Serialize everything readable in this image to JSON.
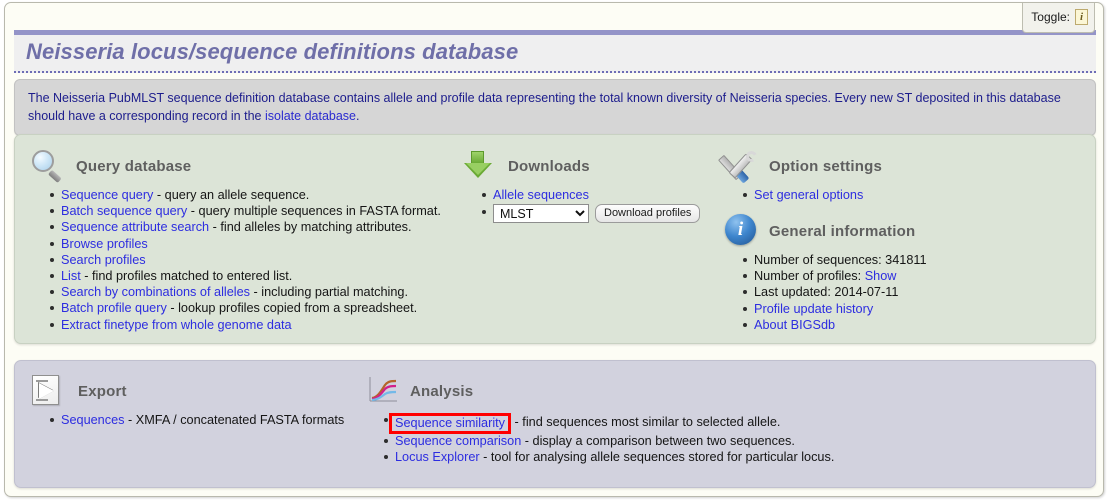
{
  "toggle": {
    "label": "Toggle:",
    "icon": "info-italic-icon"
  },
  "header": {
    "title": "Neisseria locus/sequence definitions database"
  },
  "intro": {
    "text_before_link": "The Neisseria PubMLST sequence definition database contains allele and profile data representing the total known diversity of Neisseria species. Every new ST deposited in this database should have a corresponding record in the ",
    "link_text": "isolate database",
    "text_after_link": "."
  },
  "query_section": {
    "icon": "magnifier-icon",
    "title": "Query database",
    "items": [
      {
        "link": "Sequence query",
        "rest": " - query an allele sequence."
      },
      {
        "link": "Batch sequence query",
        "rest": " - query multiple sequences in FASTA format."
      },
      {
        "link": "Sequence attribute search",
        "rest": " - find alleles by matching attributes."
      },
      {
        "link": "Browse profiles",
        "rest": ""
      },
      {
        "link": "Search profiles",
        "rest": ""
      },
      {
        "link": "List",
        "rest": " - find profiles matched to entered list."
      },
      {
        "link": "Search by combinations of alleles",
        "rest": " - including partial matching."
      },
      {
        "link": "Batch profile query",
        "rest": " - lookup profiles copied from a spreadsheet."
      },
      {
        "link": "Extract finetype from whole genome data",
        "rest": ""
      }
    ]
  },
  "downloads_section": {
    "icon": "download-arrow-icon",
    "title": "Downloads",
    "allele_link": "Allele sequences",
    "scheme_selected": "MLST",
    "scheme_options": [
      "MLST"
    ],
    "download_button": "Download profiles"
  },
  "options_section": {
    "icon": "tools-icon",
    "title": "Option settings",
    "items": [
      {
        "link": "Set general options",
        "rest": ""
      }
    ]
  },
  "general_info_section": {
    "icon": "info-ball-icon",
    "title": "General information",
    "items": [
      {
        "plain": "Number of sequences: 341811",
        "link": "",
        "rest": ""
      },
      {
        "plain": "Number of profiles: ",
        "link": "Show",
        "rest": ""
      },
      {
        "plain": "Last updated: 2014-07-11",
        "link": "",
        "rest": ""
      },
      {
        "plain": "",
        "link": "Profile update history",
        "rest": ""
      },
      {
        "plain": "",
        "link": "About BIGSdb",
        "rest": ""
      }
    ]
  },
  "export_section": {
    "icon": "export-document-icon",
    "title": "Export",
    "items": [
      {
        "link": "Sequences",
        "rest": " - XMFA / concatenated FASTA formats"
      }
    ]
  },
  "analysis_section": {
    "icon": "line-chart-icon",
    "title": "Analysis",
    "items": [
      {
        "link": "Sequence similarity",
        "rest": " - find sequences most similar to selected allele.",
        "highlighted": true
      },
      {
        "link": "Sequence comparison",
        "rest": " - display a comparison between two sequences.",
        "highlighted": false
      },
      {
        "link": "Locus Explorer",
        "rest": " - tool for analysing allele sequences stored for particular locus.",
        "highlighted": false
      }
    ]
  },
  "colors": {
    "title_text": "#6f6fa8",
    "title_rule": "#9494c8",
    "link": "#2d2de0",
    "intro_text": "#1c1c8c",
    "panel_green": "#dce4d7",
    "panel_lavender": "#d2d2de",
    "highlight_red": "#ff0000",
    "heading_gray": "#5f5f5f"
  }
}
